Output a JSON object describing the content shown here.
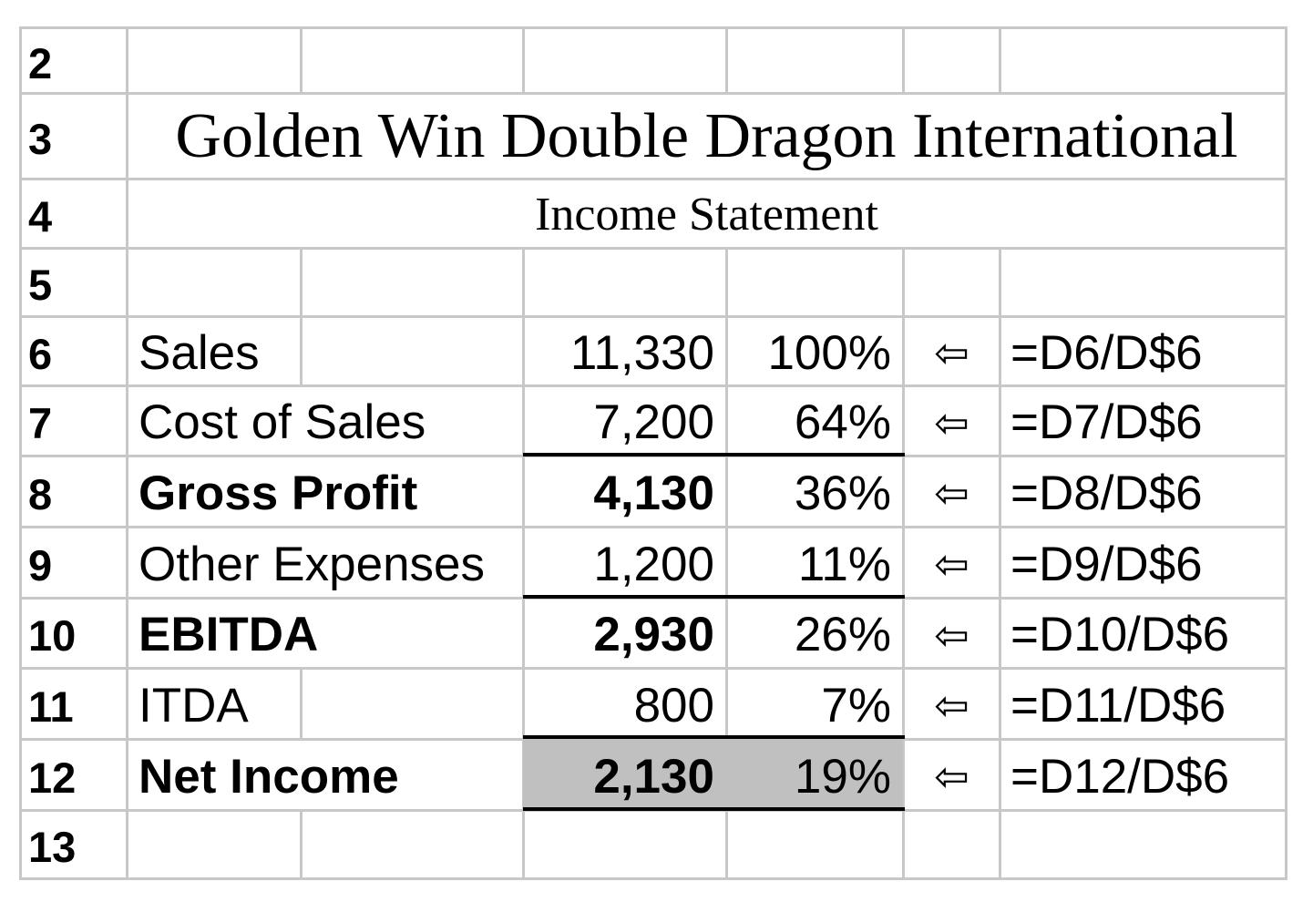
{
  "rows": [
    "2",
    "3",
    "4",
    "5",
    "6",
    "7",
    "8",
    "9",
    "10",
    "11",
    "12",
    "13"
  ],
  "title": "Golden Win Double Dragon International",
  "subtitle": "Income Statement",
  "statement": [
    {
      "label": "Sales",
      "value": "11,330",
      "pct": "100%",
      "arrow": "⇦",
      "formula": "=D6/D$6"
    },
    {
      "label": "Cost of Sales",
      "value": "7,200",
      "pct": "64%",
      "arrow": "⇦",
      "formula": "=D7/D$6"
    },
    {
      "label": "Gross Profit",
      "value": "4,130",
      "pct": "36%",
      "arrow": "⇦",
      "formula": "=D8/D$6"
    },
    {
      "label": "Other Expenses",
      "value": "1,200",
      "pct": "11%",
      "arrow": "⇦",
      "formula": "=D9/D$6"
    },
    {
      "label": "EBITDA",
      "value": "2,930",
      "pct": "26%",
      "arrow": "⇦",
      "formula": "=D10/D$6"
    },
    {
      "label": "ITDA",
      "value": "800",
      "pct": "7%",
      "arrow": "⇦",
      "formula": "=D11/D$6"
    },
    {
      "label": "Net Income",
      "value": "2,130",
      "pct": "19%",
      "arrow": "⇦",
      "formula": "=D12/D$6"
    }
  ],
  "colors": {
    "gridline": "#c8c8c8",
    "highlight": "#c0c0c0",
    "rule": "#000000"
  }
}
